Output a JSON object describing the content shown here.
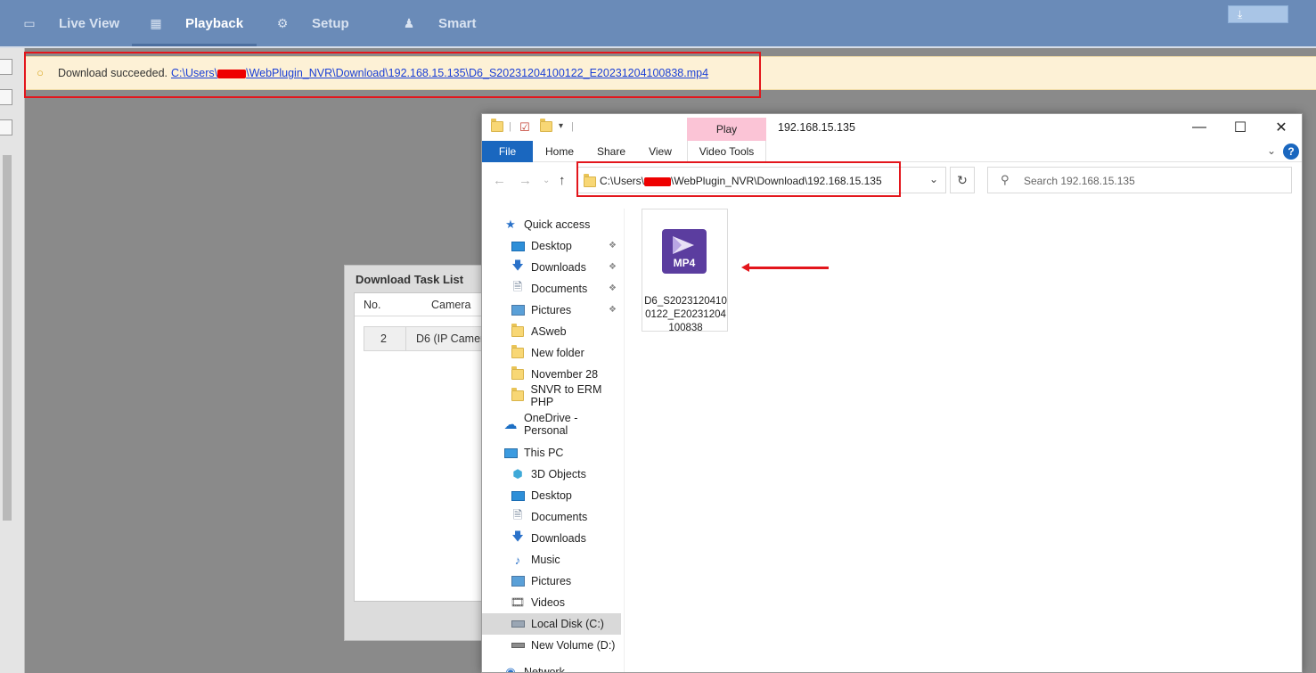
{
  "topnav": {
    "items": [
      {
        "label": "Live View",
        "icon": "monitor-icon"
      },
      {
        "label": "Playback",
        "icon": "film-icon"
      },
      {
        "label": "Setup",
        "icon": "gear-icon"
      },
      {
        "label": "Smart",
        "icon": "person-icon"
      }
    ],
    "active": "Playback",
    "download_icon": "download-icon"
  },
  "banner": {
    "message": "Download succeeded.",
    "path_prefix": "C:\\Users\\",
    "path_suffix": "\\WebPlugin_NVR\\Download\\192.168.15.135\\D6_S20231204100122_E20231204100838.mp4"
  },
  "download_task_list": {
    "title": "Download Task List",
    "columns": [
      "No.",
      "Camera"
    ],
    "rows": [
      {
        "no": "2",
        "camera": "D6 (IP Camer"
      }
    ]
  },
  "explorer": {
    "title": "192.168.15.135",
    "context_tab": "Play",
    "ribbon_tabs": [
      "File",
      "Home",
      "Share",
      "View",
      "Video Tools"
    ],
    "address": {
      "prefix": "C:\\Users\\",
      "suffix": "\\WebPlugin_NVR\\Download\\192.168.15.135"
    },
    "search_placeholder": "Search 192.168.15.135",
    "nav": [
      {
        "label": "Quick access",
        "icon": "star-icon"
      },
      {
        "label": "Desktop",
        "icon": "desktop-icon",
        "pinned": true
      },
      {
        "label": "Downloads",
        "icon": "download-arrow-icon",
        "pinned": true
      },
      {
        "label": "Documents",
        "icon": "document-icon",
        "pinned": true
      },
      {
        "label": "Pictures",
        "icon": "picture-icon",
        "pinned": true
      },
      {
        "label": "ASweb",
        "icon": "folder-icon"
      },
      {
        "label": "New folder",
        "icon": "folder-icon"
      },
      {
        "label": "November 28",
        "icon": "folder-icon"
      },
      {
        "label": "SNVR to ERM PHP",
        "icon": "folder-icon"
      },
      {
        "label": "OneDrive - Personal",
        "icon": "cloud-icon"
      },
      {
        "label": "This PC",
        "icon": "computer-icon"
      },
      {
        "label": "3D Objects",
        "icon": "cube-icon"
      },
      {
        "label": "Desktop",
        "icon": "desktop-icon"
      },
      {
        "label": "Documents",
        "icon": "document-icon"
      },
      {
        "label": "Downloads",
        "icon": "download-arrow-icon"
      },
      {
        "label": "Music",
        "icon": "music-icon"
      },
      {
        "label": "Pictures",
        "icon": "picture-icon"
      },
      {
        "label": "Videos",
        "icon": "video-icon"
      },
      {
        "label": "Local Disk (C:)",
        "icon": "disk-icon",
        "selected": true
      },
      {
        "label": "New Volume (D:)",
        "icon": "drive-icon"
      },
      {
        "label": "Network",
        "icon": "network-icon"
      }
    ],
    "file": {
      "name": "D6_S20231204100122_E20231204100838",
      "icon_label": "MP4",
      "icon": "mp4-file-icon"
    }
  },
  "colors": {
    "nav_bg": "#6a8bb8",
    "banner_bg": "#fdf1d6",
    "highlight_red": "#e3161c",
    "file_tab_blue": "#1a67bf",
    "play_tab_pink": "#fbc4d6",
    "mp4_purple": "#5b3d9f"
  }
}
